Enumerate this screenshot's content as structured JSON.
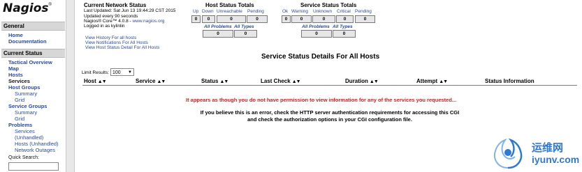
{
  "nav": {
    "logo": "Nagios",
    "logo_reg": "®",
    "general_header": "General",
    "home": "Home",
    "documentation": "Documentation",
    "current_status_header": "Current Status",
    "tactical_overview": "Tactical Overview",
    "map": "Map",
    "hosts": "Hosts",
    "services": "Services",
    "host_groups": "Host Groups",
    "host_groups_summary": "Summary",
    "host_groups_grid": "Grid",
    "service_groups": "Service Groups",
    "service_groups_summary": "Summary",
    "service_groups_grid": "Grid",
    "problems": "Problems",
    "problems_services": "Services",
    "problems_unhandled": "(Unhandled)",
    "problems_hosts_unhandled": "Hosts (Unhandled)",
    "network_outages": "Network Outages",
    "quick_search_label": "Quick Search:",
    "quick_search_value": ""
  },
  "info": {
    "title": "Current Network Status",
    "last_updated": "Last Updated: Sat Jun 13 19:44:29 CST 2015",
    "update_every": "Updated every 90 seconds",
    "core_prefix": "Nagios® Core™ 4.0.8 - ",
    "core_link": "www.nagios.org",
    "logged_in": "Logged in as kylinlin",
    "link_history": "View History For all hosts",
    "link_notifications": "View Notifications For All Hosts",
    "link_host_status": "View Host Status Detail For All Hosts"
  },
  "host_totals": {
    "title": "Host Status Totals",
    "headers": [
      "Up",
      "Down",
      "Unreachable",
      "Pending"
    ],
    "values": [
      "0",
      "0",
      "0",
      "0"
    ],
    "all_problems_label": "All Problems",
    "all_types_label": "All Types",
    "all_problems_value": "0",
    "all_types_value": "0"
  },
  "service_totals": {
    "title": "Service Status Totals",
    "headers": [
      "Ok",
      "Warning",
      "Unknown",
      "Critical",
      "Pending"
    ],
    "values": [
      "0",
      "0",
      "0",
      "0",
      "0"
    ],
    "all_problems_label": "All Problems",
    "all_types_label": "All Types",
    "all_problems_value": "0",
    "all_types_value": "0"
  },
  "details": {
    "title": "Service Status Details For All Hosts",
    "limit_label": "Limit Results:",
    "limit_value": "100",
    "columns": [
      "Host",
      "Service",
      "Status",
      "Last Check",
      "Duration",
      "Attempt",
      "Status Information"
    ],
    "error_text": "It appears as though you do not have permission to view information for any of the services you requested...",
    "note_line1": "If you believe this is an error, check the HTTP server authentication requirements for accessing this CGI",
    "note_line2": "and check the authorization options in your CGI configuration file."
  },
  "watermark": {
    "cn": "运维网",
    "en": "iyunv.com"
  },
  "colors": {
    "link": "#2a4aa0",
    "error": "#d32020",
    "nav_header_bg": "#d7d7d7",
    "watermark": "#2f79d4"
  }
}
